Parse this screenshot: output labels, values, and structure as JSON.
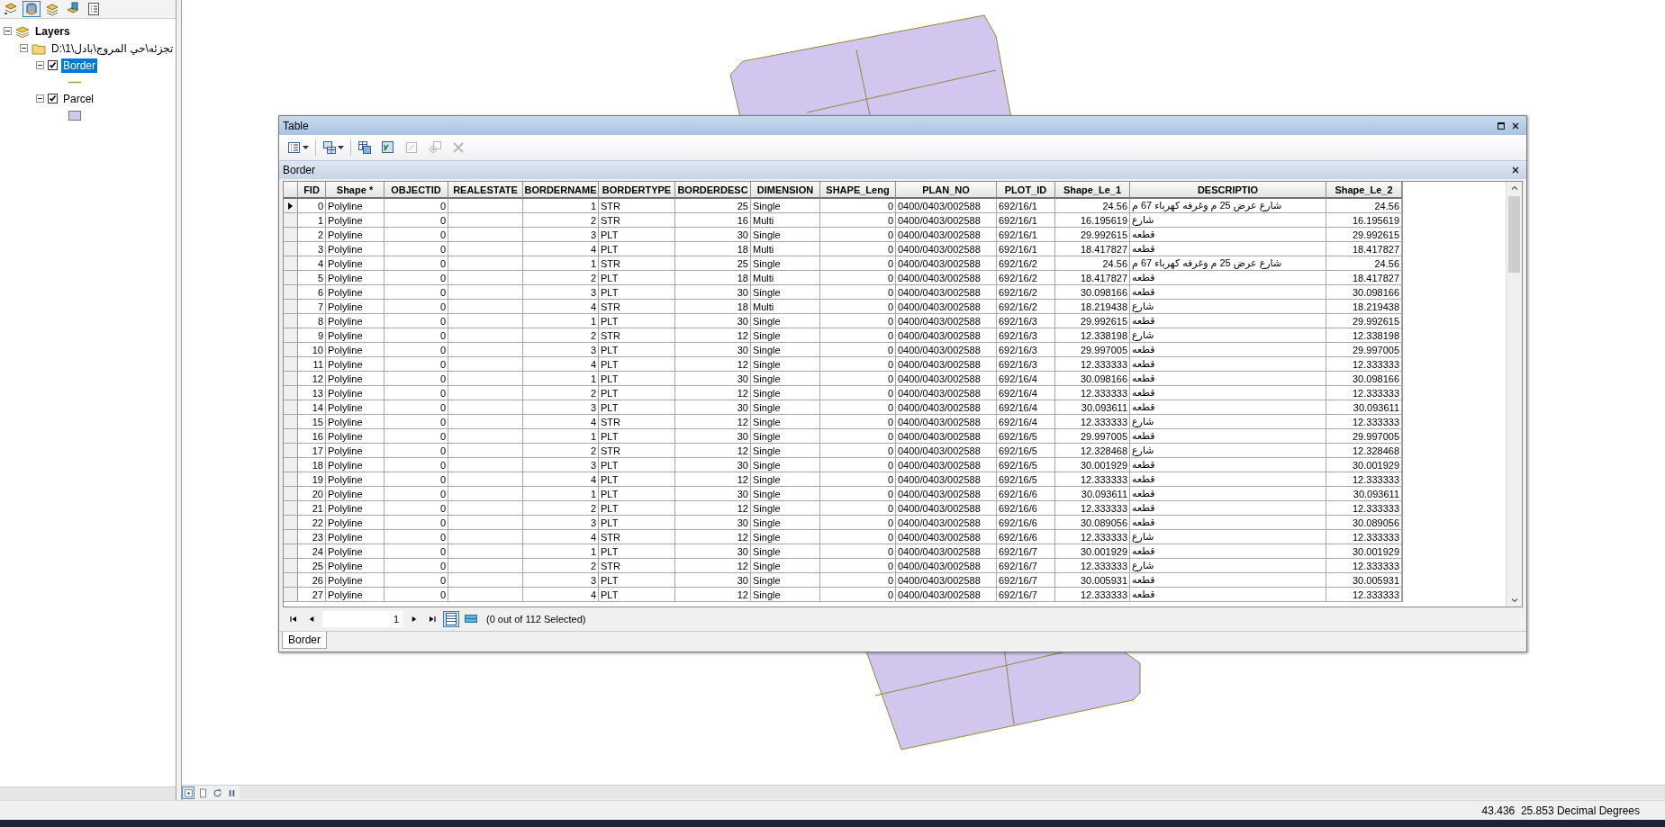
{
  "toc": {
    "tools": [
      {
        "kind": "drawing-order",
        "selected": false
      },
      {
        "kind": "source",
        "selected": true
      },
      {
        "kind": "visibility",
        "selected": false
      },
      {
        "kind": "selection",
        "selected": false
      },
      {
        "kind": "options",
        "selected": false
      }
    ],
    "tree": [
      {
        "kind": "frame",
        "label": "Layers",
        "expanded": true,
        "children": [
          {
            "kind": "folder",
            "label": "D:\\1\\تجزئه\\حي المروج\\بادل",
            "expanded": true,
            "children": [
              {
                "kind": "layer",
                "label": "Border",
                "expanded": true,
                "checked": true,
                "selected": true,
                "legend": {
                  "kind": "line"
                }
              },
              {
                "kind": "layer",
                "label": "Parcel",
                "expanded": true,
                "checked": true,
                "selected": false,
                "legend": {
                  "kind": "polygon"
                }
              }
            ]
          }
        ]
      }
    ]
  },
  "table_window": {
    "title": "Table",
    "toolbar": [
      {
        "kind": "table-options",
        "disabled": false
      },
      {
        "kind": "related-tables",
        "disabled": false
      },
      {
        "kind": "select-by-attributes",
        "disabled": false
      },
      {
        "kind": "switch-selection",
        "disabled": false
      },
      {
        "kind": "clear-selection",
        "disabled": true
      },
      {
        "kind": "zoom-selected",
        "disabled": true
      },
      {
        "kind": "delete",
        "disabled": true
      }
    ],
    "table_name": "Border",
    "columns": [
      {
        "label": "FID",
        "kind": "number"
      },
      {
        "label": "Shape *",
        "kind": "text"
      },
      {
        "label": "OBJECTID",
        "kind": "number"
      },
      {
        "label": "REALESTATE",
        "kind": "text"
      },
      {
        "label": "BORDERNAME",
        "kind": "number"
      },
      {
        "label": "BORDERTYPE",
        "kind": "text"
      },
      {
        "label": "BORDERDESC",
        "kind": "number"
      },
      {
        "label": "DIMENSION",
        "kind": "text"
      },
      {
        "label": "SHAPE_Leng",
        "kind": "number"
      },
      {
        "label": "PLAN_NO",
        "kind": "text"
      },
      {
        "label": "PLOT_ID",
        "kind": "text"
      },
      {
        "label": "Shape_Le_1",
        "kind": "number"
      },
      {
        "label": "DESCRIPTIO",
        "kind": "text"
      },
      {
        "label": "Shape_Le_2",
        "kind": "number"
      }
    ],
    "rows": [
      {
        "current": true,
        "cells": [
          "0",
          "Polyline",
          "0",
          null,
          "1",
          "STR",
          "25",
          "Single",
          "0",
          "0400/0403/002588",
          "692/16/1",
          "24.56",
          "شارع عرض 25 م وغرفه كهرباء 67 م",
          "24.56"
        ]
      },
      {
        "current": false,
        "cells": [
          "1",
          "Polyline",
          "0",
          null,
          "2",
          "STR",
          "16",
          "Multi",
          "0",
          "0400/0403/002588",
          "692/16/1",
          "16.195619",
          "شارع",
          "16.195619"
        ]
      },
      {
        "current": false,
        "cells": [
          "2",
          "Polyline",
          "0",
          null,
          "3",
          "PLT",
          "30",
          "Single",
          "0",
          "0400/0403/002588",
          "692/16/1",
          "29.992615",
          "قطعه",
          "29.992615"
        ]
      },
      {
        "current": false,
        "cells": [
          "3",
          "Polyline",
          "0",
          null,
          "4",
          "PLT",
          "18",
          "Multi",
          "0",
          "0400/0403/002588",
          "692/16/1",
          "18.417827",
          "قطعه",
          "18.417827"
        ]
      },
      {
        "current": false,
        "cells": [
          "4",
          "Polyline",
          "0",
          null,
          "1",
          "STR",
          "25",
          "Single",
          "0",
          "0400/0403/002588",
          "692/16/2",
          "24.56",
          "شارع عرض 25 م وغرفه كهرباء 67 م",
          "24.56"
        ]
      },
      {
        "current": false,
        "cells": [
          "5",
          "Polyline",
          "0",
          null,
          "2",
          "PLT",
          "18",
          "Multi",
          "0",
          "0400/0403/002588",
          "692/16/2",
          "18.417827",
          "قطعه",
          "18.417827"
        ]
      },
      {
        "current": false,
        "cells": [
          "6",
          "Polyline",
          "0",
          null,
          "3",
          "PLT",
          "30",
          "Single",
          "0",
          "0400/0403/002588",
          "692/16/2",
          "30.098166",
          "قطعه",
          "30.098166"
        ]
      },
      {
        "current": false,
        "cells": [
          "7",
          "Polyline",
          "0",
          null,
          "4",
          "STR",
          "18",
          "Multi",
          "0",
          "0400/0403/002588",
          "692/16/2",
          "18.219438",
          "شارع",
          "18.219438"
        ]
      },
      {
        "current": false,
        "cells": [
          "8",
          "Polyline",
          "0",
          null,
          "1",
          "PLT",
          "30",
          "Single",
          "0",
          "0400/0403/002588",
          "692/16/3",
          "29.992615",
          "قطعه",
          "29.992615"
        ]
      },
      {
        "current": false,
        "cells": [
          "9",
          "Polyline",
          "0",
          null,
          "2",
          "STR",
          "12",
          "Single",
          "0",
          "0400/0403/002588",
          "692/16/3",
          "12.338198",
          "شارع",
          "12.338198"
        ]
      },
      {
        "current": false,
        "cells": [
          "10",
          "Polyline",
          "0",
          null,
          "3",
          "PLT",
          "30",
          "Single",
          "0",
          "0400/0403/002588",
          "692/16/3",
          "29.997005",
          "قطعه",
          "29.997005"
        ]
      },
      {
        "current": false,
        "cells": [
          "11",
          "Polyline",
          "0",
          null,
          "4",
          "PLT",
          "12",
          "Single",
          "0",
          "0400/0403/002588",
          "692/16/3",
          "12.333333",
          "قطعه",
          "12.333333"
        ]
      },
      {
        "current": false,
        "cells": [
          "12",
          "Polyline",
          "0",
          null,
          "1",
          "PLT",
          "30",
          "Single",
          "0",
          "0400/0403/002588",
          "692/16/4",
          "30.098166",
          "قطعه",
          "30.098166"
        ]
      },
      {
        "current": false,
        "cells": [
          "13",
          "Polyline",
          "0",
          null,
          "2",
          "PLT",
          "12",
          "Single",
          "0",
          "0400/0403/002588",
          "692/16/4",
          "12.333333",
          "قطعه",
          "12.333333"
        ]
      },
      {
        "current": false,
        "cells": [
          "14",
          "Polyline",
          "0",
          null,
          "3",
          "PLT",
          "30",
          "Single",
          "0",
          "0400/0403/002588",
          "692/16/4",
          "30.093611",
          "قطعه",
          "30.093611"
        ]
      },
      {
        "current": false,
        "cells": [
          "15",
          "Polyline",
          "0",
          null,
          "4",
          "STR",
          "12",
          "Single",
          "0",
          "0400/0403/002588",
          "692/16/4",
          "12.333333",
          "شارع",
          "12.333333"
        ]
      },
      {
        "current": false,
        "cells": [
          "16",
          "Polyline",
          "0",
          null,
          "1",
          "PLT",
          "30",
          "Single",
          "0",
          "0400/0403/002588",
          "692/16/5",
          "29.997005",
          "قطعه",
          "29.997005"
        ]
      },
      {
        "current": false,
        "cells": [
          "17",
          "Polyline",
          "0",
          null,
          "2",
          "STR",
          "12",
          "Single",
          "0",
          "0400/0403/002588",
          "692/16/5",
          "12.328468",
          "شارع",
          "12.328468"
        ]
      },
      {
        "current": false,
        "cells": [
          "18",
          "Polyline",
          "0",
          null,
          "3",
          "PLT",
          "30",
          "Single",
          "0",
          "0400/0403/002588",
          "692/16/5",
          "30.001929",
          "قطعه",
          "30.001929"
        ]
      },
      {
        "current": false,
        "cells": [
          "19",
          "Polyline",
          "0",
          null,
          "4",
          "PLT",
          "12",
          "Single",
          "0",
          "0400/0403/002588",
          "692/16/5",
          "12.333333",
          "قطعه",
          "12.333333"
        ]
      },
      {
        "current": false,
        "cells": [
          "20",
          "Polyline",
          "0",
          null,
          "1",
          "PLT",
          "30",
          "Single",
          "0",
          "0400/0403/002588",
          "692/16/6",
          "30.093611",
          "قطعه",
          "30.093611"
        ]
      },
      {
        "current": false,
        "cells": [
          "21",
          "Polyline",
          "0",
          null,
          "2",
          "PLT",
          "12",
          "Single",
          "0",
          "0400/0403/002588",
          "692/16/6",
          "12.333333",
          "قطعه",
          "12.333333"
        ]
      },
      {
        "current": false,
        "cells": [
          "22",
          "Polyline",
          "0",
          null,
          "3",
          "PLT",
          "30",
          "Single",
          "0",
          "0400/0403/002588",
          "692/16/6",
          "30.089056",
          "قطعه",
          "30.089056"
        ]
      },
      {
        "current": false,
        "cells": [
          "23",
          "Polyline",
          "0",
          null,
          "4",
          "STR",
          "12",
          "Single",
          "0",
          "0400/0403/002588",
          "692/16/6",
          "12.333333",
          "شارع",
          "12.333333"
        ]
      },
      {
        "current": false,
        "cells": [
          "24",
          "Polyline",
          "0",
          null,
          "1",
          "PLT",
          "30",
          "Single",
          "0",
          "0400/0403/002588",
          "692/16/7",
          "30.001929",
          "قطعه",
          "30.001929"
        ]
      },
      {
        "current": false,
        "cells": [
          "25",
          "Polyline",
          "0",
          null,
          "2",
          "STR",
          "12",
          "Single",
          "0",
          "0400/0403/002588",
          "692/16/7",
          "12.333333",
          "شارع",
          "12.333333"
        ]
      },
      {
        "current": false,
        "cells": [
          "26",
          "Polyline",
          "0",
          null,
          "3",
          "PLT",
          "30",
          "Single",
          "0",
          "0400/0403/002588",
          "692/16/7",
          "30.005931",
          "قطعه",
          "30.005931"
        ]
      },
      {
        "current": false,
        "cells": [
          "27",
          "Polyline",
          "0",
          null,
          "4",
          "PLT",
          "12",
          "Single",
          "0",
          "0400/0403/002588",
          "692/16/7",
          "12.333333",
          "قطعه",
          "12.333333"
        ]
      }
    ],
    "navigation": {
      "record": "1",
      "views": [
        {
          "kind": "all",
          "selected": true
        },
        {
          "kind": "selected",
          "selected": false
        }
      ],
      "selection_status": "(0 out of 112 Selected)"
    },
    "tabs": [
      {
        "label": "Border",
        "selected": true
      }
    ]
  },
  "status_bar": {
    "coordinates": "43.436  25.853 Decimal Degrees"
  }
}
